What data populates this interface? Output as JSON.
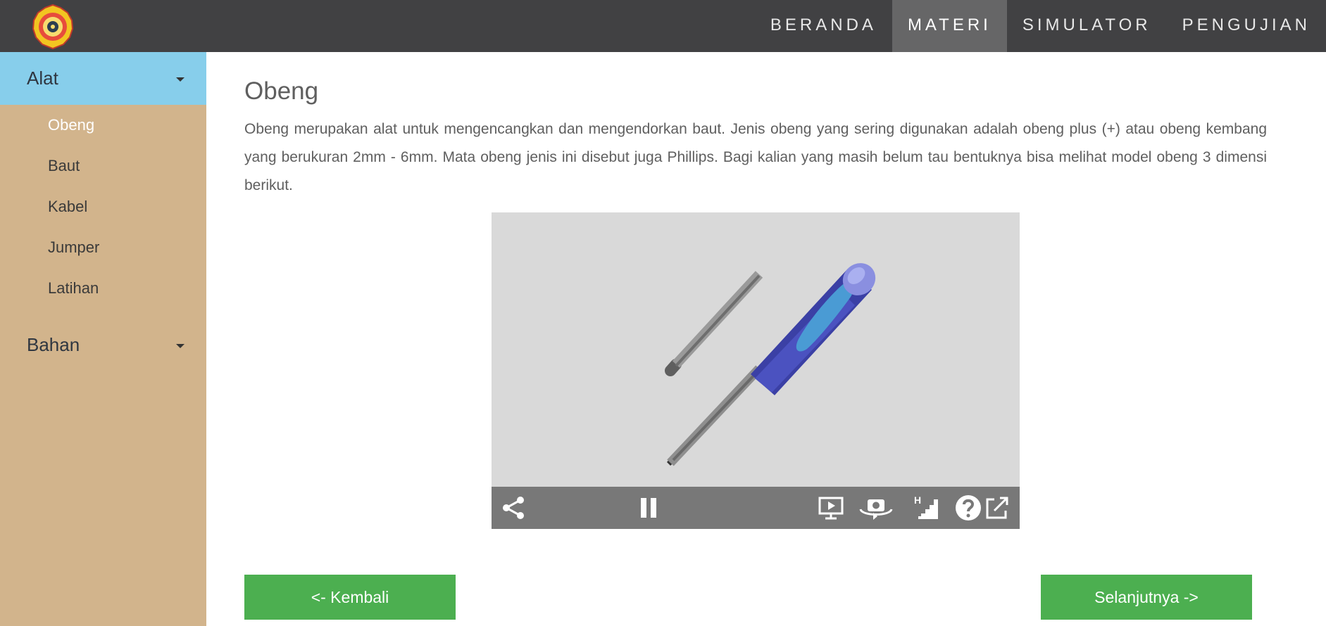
{
  "nav": {
    "items": [
      {
        "label": "BERANDA"
      },
      {
        "label": "MATERI"
      },
      {
        "label": "SIMULATOR"
      },
      {
        "label": "PENGUJIAN"
      }
    ],
    "active_index": 1
  },
  "sidebar": {
    "groups": [
      {
        "label": "Alat",
        "items": [
          "Obeng",
          "Baut",
          "Kabel",
          "Jumper",
          "Latihan"
        ]
      },
      {
        "label": "Bahan"
      }
    ],
    "current_item": "Obeng"
  },
  "main": {
    "title": "Obeng",
    "description": "Obeng merupakan alat untuk mengencangkan dan mengendorkan baut. Jenis obeng yang sering digunakan adalah obeng plus (+) atau obeng kembang yang berukuran 2mm - 6mm. Mata obeng jenis ini disebut juga Phillips. Bagi kalian yang masih belum tau bentuknya bisa melihat model obeng 3 dimensi berikut.",
    "viewer": {
      "controls": [
        "share-icon",
        "pause-icon",
        "present-icon",
        "camera-rotate-icon",
        "hd-quality-icon",
        "help-icon",
        "external-link-icon"
      ],
      "quality_label": "H"
    },
    "buttons": {
      "back": "<- Kembali",
      "next": "Selanjutnya ->"
    }
  },
  "colors": {
    "navbar": "#414143",
    "nav_active": "#666667",
    "sidebar": "#d2b48c",
    "sidebar_active": "#87ceeb",
    "button": "#4caf50",
    "viewer_bg": "#d9d9d9",
    "viewer_bar": "#787878",
    "handle": "#4a4fb0"
  }
}
